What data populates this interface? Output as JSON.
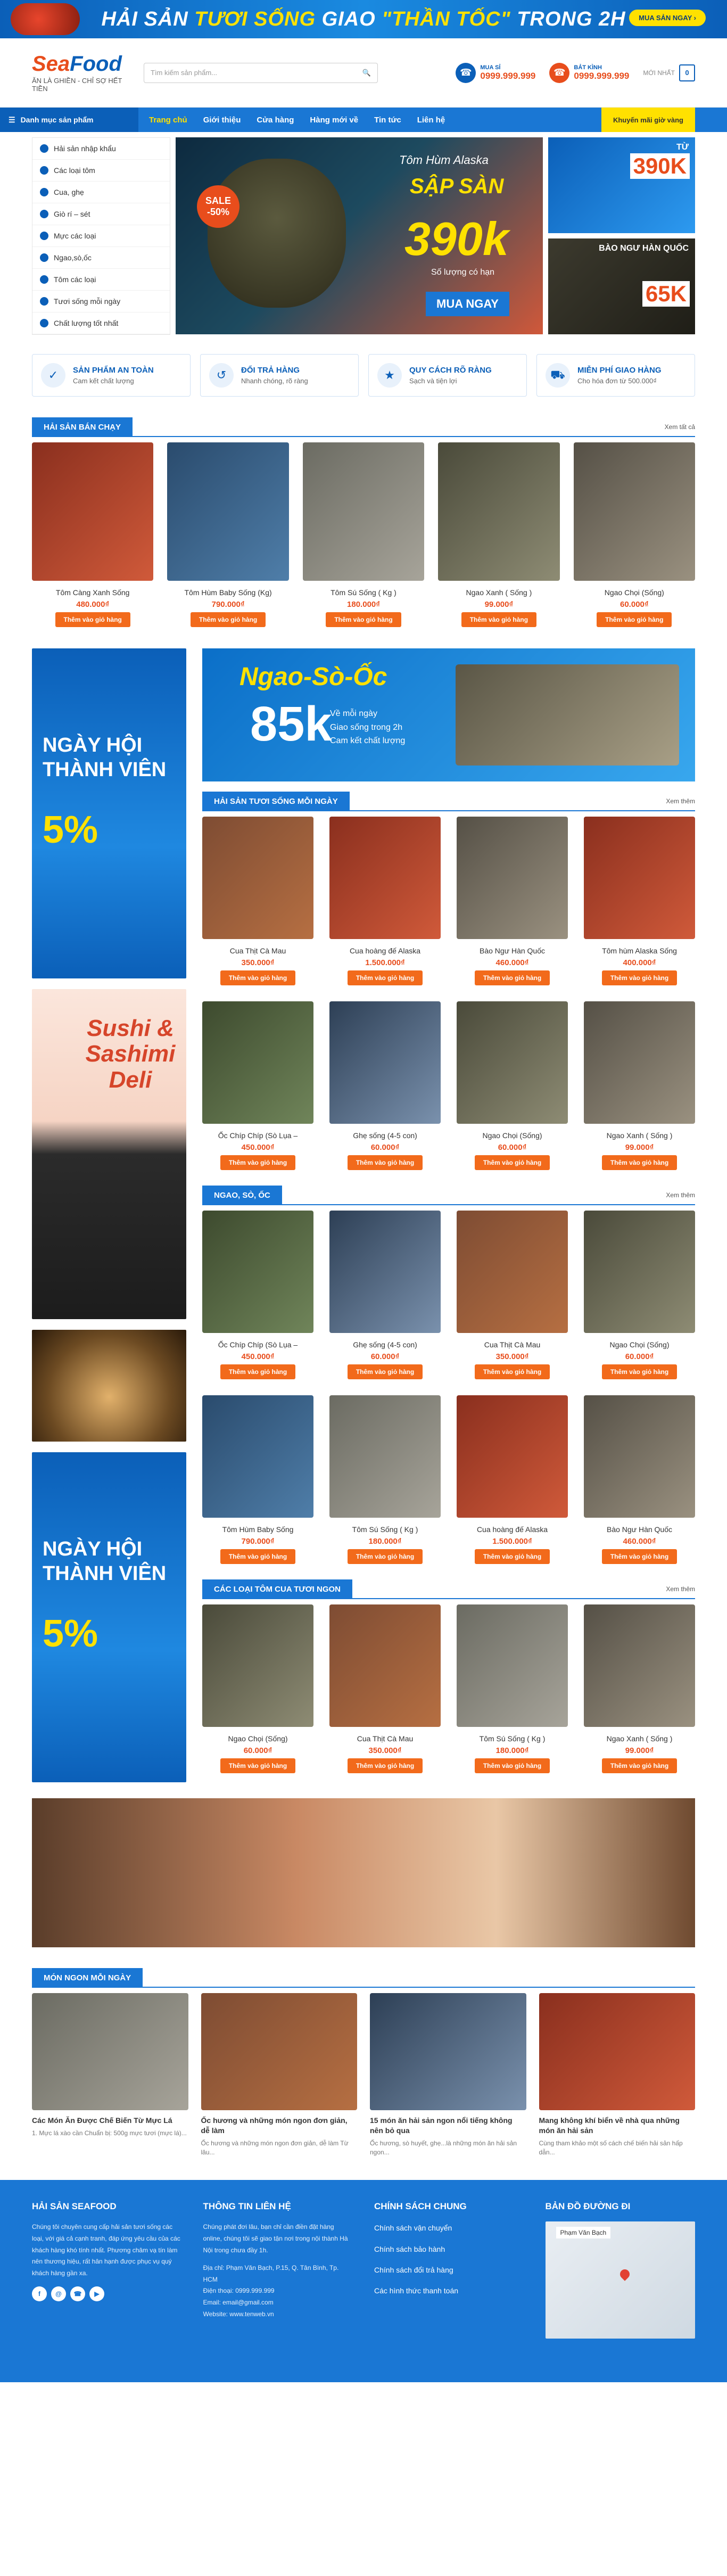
{
  "top_banner": {
    "part1": "HẢI SẢN",
    "part2": "TƯƠI SỐNG",
    "part3": "GIAO",
    "part4": "\"THẦN TỐC\"",
    "part5": "TRONG 2H",
    "cta": "MUA SẢN NGAY ›"
  },
  "header": {
    "logo_a": "Sea",
    "logo_b": "Food",
    "tagline": "ĂN LÀ GHIỀN - CHỈ SỢ HẾT TIỀN",
    "search_placeholder": "Tìm kiếm sản phẩm...",
    "phone1_label": "MUA SỈ",
    "phone1": "0999.999.999",
    "phone2_label": "BẢT KÌNH",
    "phone2": "0999.999.999",
    "cart_label": "MỚI NHẤT",
    "cart_count": "0"
  },
  "nav": {
    "category_button": "Danh mục sản phẩm",
    "links": [
      "Trang chủ",
      "Giới thiệu",
      "Cửa hàng",
      "Hàng mới về",
      "Tin tức",
      "Liên hệ"
    ],
    "promo": "Khuyến mãi giờ vàng"
  },
  "categories": [
    "Hải sản nhập khẩu",
    "Các loại tôm",
    "Cua, ghẹ",
    "Giò rí – sét",
    "Mực các loại",
    "Ngao,sò,ốc",
    "Tôm các loại",
    "Tươi sống mỗi ngày",
    "Chất lượng tốt nhất"
  ],
  "hero": {
    "sale": "SALE -50%",
    "l1": "Tôm Hùm Alaska",
    "l2": "SẬP SÀN",
    "l3": "390k",
    "l4": "Số lượng có hạn",
    "buy": "MUA NGAY",
    "side1_label": "TỪ",
    "side1_price": "390K",
    "side2_label": "BÀO NGƯ HÀN QUỐC",
    "side2_price": "65K"
  },
  "services": [
    {
      "title": "SẢN PHẨM AN TOÀN",
      "sub": "Cam kết chất lượng"
    },
    {
      "title": "ĐỔI TRẢ HÀNG",
      "sub": "Nhanh chóng, rõ ràng"
    },
    {
      "title": "QUY CÁCH RÕ RÀNG",
      "sub": "Sạch và tiện lợi"
    },
    {
      "title": "MIỄN PHÍ GIAO HÀNG",
      "sub": "Cho hóa đơn từ 500.000₫"
    }
  ],
  "best": {
    "title": "HẢI SẢN BÁN CHẠY",
    "more": "Xem tất cả",
    "items": [
      {
        "name": "Tôm Càng Xanh Sống",
        "price": "480.000₫"
      },
      {
        "name": "Tôm Hùm Baby Sống (Kg)",
        "price": "790.000₫"
      },
      {
        "name": "Tôm Sú Sống ( Kg )",
        "price": "180.000₫"
      },
      {
        "name": "Ngao Xanh ( Sống )",
        "price": "99.000₫"
      },
      {
        "name": "Ngao Chọi (Sống)",
        "price": "60.000₫"
      }
    ]
  },
  "add_btn": "Thêm vào giỏ hàng",
  "left_banners": {
    "b1": "NGÀY HỘI THÀNH VIÊN",
    "b1_pct": "5%",
    "sushi": "Sushi & Sashimi Deli"
  },
  "oc_banner": {
    "t": "Ngao-Sò-Ốc",
    "p": "85k",
    "l1": "Về mỗi ngày",
    "l2": "Giao sống trong 2h",
    "l3": "Cam kết chất lượng"
  },
  "fresh": {
    "title": "HẢI SẢN TƯƠI SỐNG MỖI NGÀY",
    "more": "Xem thêm",
    "items": [
      {
        "name": "Cua Thịt Cà Mau",
        "price": "350.000₫"
      },
      {
        "name": "Cua hoàng đế Alaska",
        "price": "1.500.000₫"
      },
      {
        "name": "Bào Ngư Hàn Quốc",
        "price": "460.000₫"
      },
      {
        "name": "Tôm hùm Alaska Sống",
        "price": "400.000₫"
      },
      {
        "name": "Ốc Chíp Chíp (Sò Lụa –",
        "price": "450.000₫"
      },
      {
        "name": "Ghẹ sống (4-5 con)",
        "price": "60.000₫"
      },
      {
        "name": "Ngao Chọi (Sống)",
        "price": "60.000₫"
      },
      {
        "name": "Ngao Xanh ( Sống )",
        "price": "99.000₫"
      }
    ]
  },
  "ngao": {
    "title": "NGAO, SÒ, ỐC",
    "more": "Xem thêm",
    "items": [
      {
        "name": "Ốc Chíp Chíp (Sò Lụa –",
        "price": "450.000₫"
      },
      {
        "name": "Ghẹ sống (4-5 con)",
        "price": "60.000₫"
      },
      {
        "name": "Cua Thịt Cà Mau",
        "price": "350.000₫"
      },
      {
        "name": "Ngao Chọi (Sống)",
        "price": "60.000₫"
      },
      {
        "name": "Tôm Hùm Baby Sống",
        "price": "790.000₫"
      },
      {
        "name": "Tôm Sú Sống ( Kg )",
        "price": "180.000₫"
      },
      {
        "name": "Cua hoàng đế Alaska",
        "price": "1.500.000₫"
      },
      {
        "name": "Bào Ngư Hàn Quốc",
        "price": "460.000₫"
      }
    ]
  },
  "tomcua": {
    "title": "CÁC LOẠI TÔM CUA TƯƠI NGON",
    "more": "Xem thêm",
    "items": [
      {
        "name": "Ngao Chọi (Sống)",
        "price": "60.000₫"
      },
      {
        "name": "Cua Thịt Cà Mau",
        "price": "350.000₫"
      },
      {
        "name": "Tôm Sú Sống ( Kg )",
        "price": "180.000₫"
      },
      {
        "name": "Ngao Xanh ( Sống )",
        "price": "99.000₫"
      }
    ]
  },
  "news": {
    "title": "MÓN NGON MỖI NGÀY",
    "items": [
      {
        "h": "Các Món Ăn Được Chế Biến Từ Mực Lá",
        "s": "1. Mực lá xào cần Chuẩn bị: 500g mực tươi (mực lá)..."
      },
      {
        "h": "Ốc hương và những món ngon đơn giản, dễ làm",
        "s": "Ốc hương và những món ngon đơn giản, dễ làm Từ lâu..."
      },
      {
        "h": "15 món ăn hải sản ngon nổi tiếng không nên bỏ qua",
        "s": "Ốc hương, sò huyết, ghẹ...là những món ăn hải sản ngon..."
      },
      {
        "h": "Mang không khí biển về nhà qua những món ăn hải sản",
        "s": "Cùng tham khảo một số cách chế biến hải sản hấp dẫn..."
      }
    ]
  },
  "footer": {
    "about_title": "HẢI SẢN SEAFOOD",
    "about": "Chúng tôi chuyên cung cấp hải sản tươi sống các loại, với giá cả cạnh tranh, đáp ứng yêu cầu của các khách hàng khó tính nhất. Phương châm vạ tín làm nên thương hiệu, rất hân hạnh được phục vụ quý khách hàng gần xa.",
    "contact_title": "THÔNG TIN LIÊN HỆ",
    "contact_intro": "Chúng phát đơi lâu, bạn chỉ cần điền đặt hàng online, chúng tôi sẽ giao tận nơi trong nội thành Hà Nội trong chưa đầy 1h.",
    "addr": "Địa chỉ: Phạm Văn Bạch, P.15, Q. Tân Bình, Tp. HCM",
    "phone": "Điện thoại: 0999.999.999",
    "email": "Email: email@gmail.com",
    "web": "Website: www.tenweb.vn",
    "policy_title": "CHÍNH SÁCH CHUNG",
    "policies": [
      "Chính sách vận chuyển",
      "Chính sách bảo hành",
      "Chính sách đổi trả hàng",
      "Các hình thức thanh toán"
    ],
    "map_title": "BẢN ĐỒ ĐƯỜNG ĐI",
    "map_label": "Phạm Văn Bạch"
  }
}
